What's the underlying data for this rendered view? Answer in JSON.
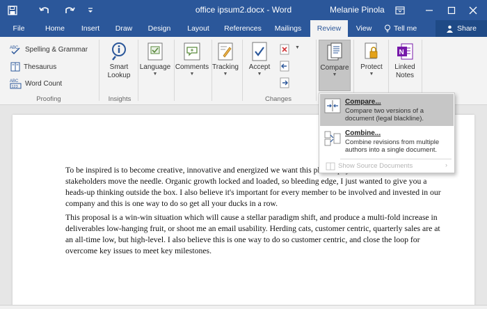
{
  "window": {
    "title": "office ipsum2.docx - Word",
    "user": "Melanie Pinola",
    "colors": {
      "brand": "#2b579a",
      "ribbon_bg": "#f3f3f3",
      "doc_bg": "#e6e6e6"
    }
  },
  "tabs": [
    {
      "label": "File"
    },
    {
      "label": "Home"
    },
    {
      "label": "Insert"
    },
    {
      "label": "Draw"
    },
    {
      "label": "Design"
    },
    {
      "label": "Layout"
    },
    {
      "label": "References"
    },
    {
      "label": "Mailings"
    },
    {
      "label": "Review",
      "active": true
    },
    {
      "label": "View"
    }
  ],
  "tell_me": "Tell me",
  "share": "Share",
  "ribbon": {
    "proofing": {
      "label": "Proofing",
      "spelling": "Spelling & Grammar",
      "thesaurus": "Thesaurus",
      "word_count": "Word Count"
    },
    "insights": {
      "label": "Insights",
      "smart_lookup_1": "Smart",
      "smart_lookup_2": "Lookup"
    },
    "language": "Language",
    "comments": "Comments",
    "tracking": "Tracking",
    "changes": {
      "label": "Changes",
      "accept": "Accept"
    },
    "compare": "Compare",
    "protect": "Protect",
    "linked_notes_1": "Linked",
    "linked_notes_2": "Notes"
  },
  "compare_menu": {
    "compare_title": "Compare...",
    "compare_desc": "Compare two versions of a document (legal blackline).",
    "combine_title": "Combine...",
    "combine_desc": "Combine revisions from multiple authors into a single document.",
    "show_source": "Show Source Documents"
  },
  "document": {
    "paragraph1": "To be inspired is to become creative, innovative and energized we want this philosophy to trickle down to all our stakeholders move the needle.  Organic growth locked and loaded, so bleeding edge, I just wanted to give you a heads-up thinking outside the box.  I also believe it's important for every member to be involved and invested in our company and this is one way to do so get all your ducks in a row.",
    "paragraph2": "This proposal is a win-win situation which will cause a stellar paradigm shift, and produce a multi-fold increase in deliverables low-hanging fruit, or shoot me an email usability.  Herding cats, customer centric, quarterly sales are at an all-time low, but high-level.  I also believe this is one way to do so customer centric, and close the loop for overcome key issues to meet key milestones."
  }
}
